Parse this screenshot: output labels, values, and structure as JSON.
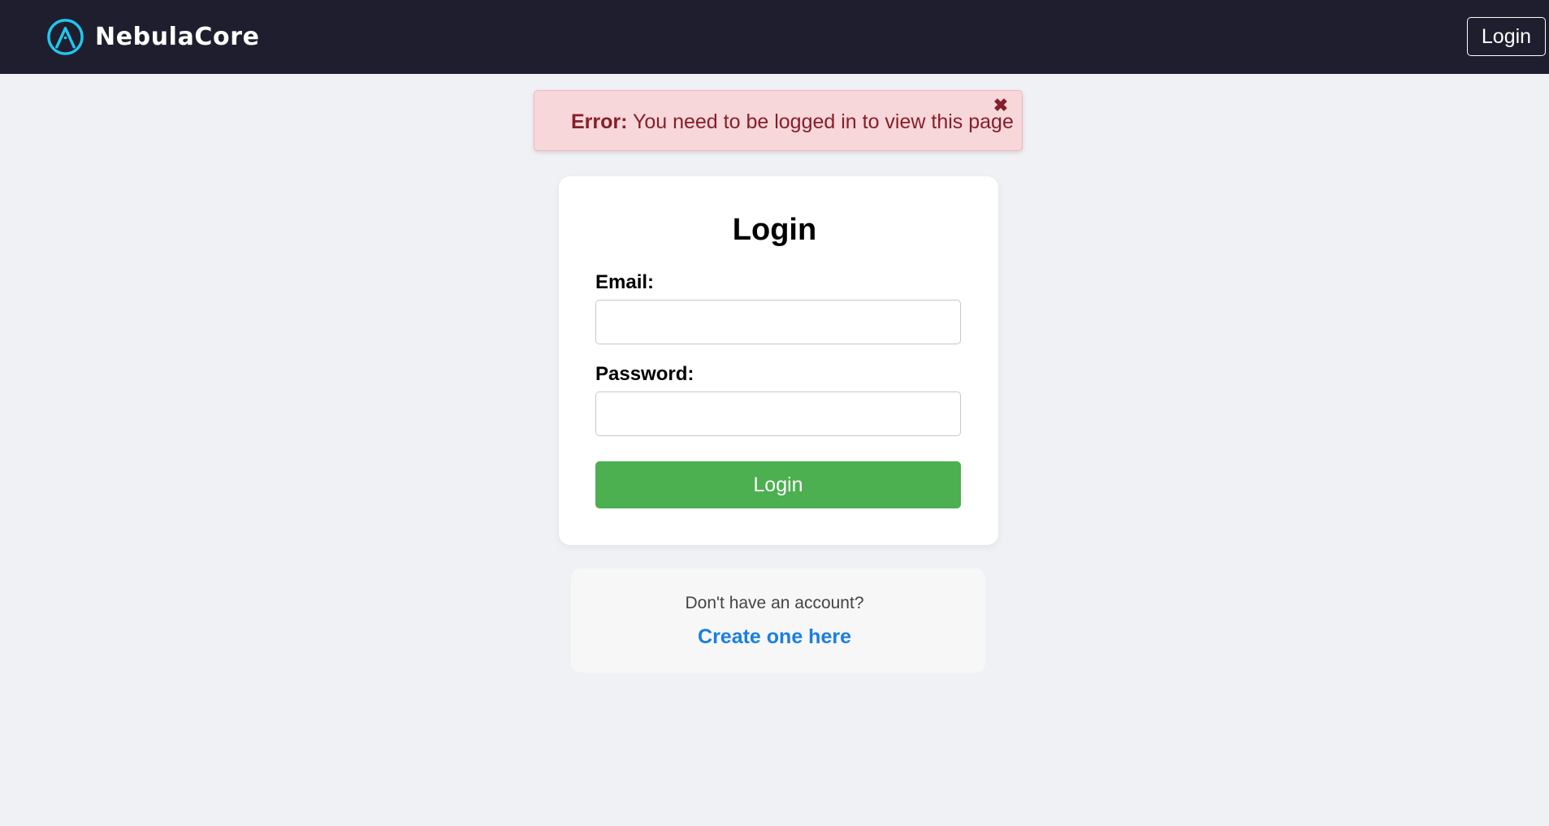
{
  "navbar": {
    "brand_name": "NebulaCore",
    "logo_icon": "nebula-logo-icon",
    "login_button": "Login"
  },
  "alert": {
    "prefix": "Error:",
    "message": " You need to be logged in to view this page",
    "close_icon": "close-icon",
    "close_symbol": "✖"
  },
  "login_form": {
    "title": "Login",
    "email_label": "Email:",
    "email_value": "",
    "password_label": "Password:",
    "password_value": "",
    "submit_label": "Login"
  },
  "signup": {
    "prompt": "Don't have an account?",
    "link_text": "Create one here"
  },
  "colors": {
    "navbar_bg": "#1e1e2e",
    "accent_cyan": "#1ec8f0",
    "alert_bg": "#f8d7da",
    "alert_text": "#842029",
    "submit_bg": "#4caf50",
    "link": "#1a7fe0"
  }
}
